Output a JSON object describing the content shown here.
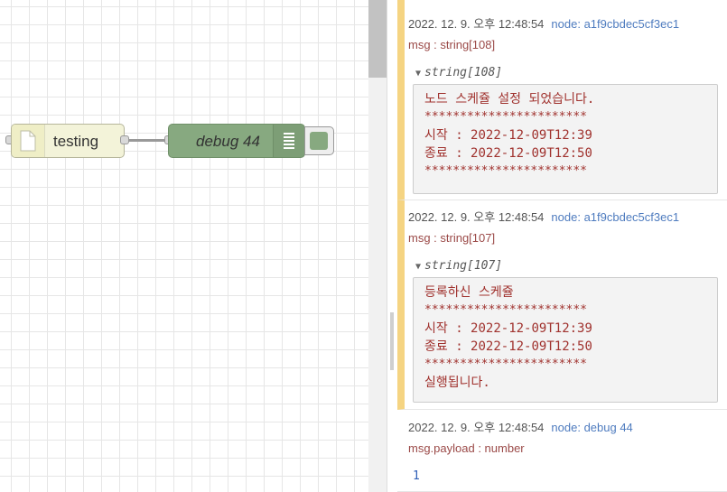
{
  "workspace": {
    "inject_node": {
      "label": "testing",
      "icon": "file-icon"
    },
    "debug_node": {
      "label": "debug 44",
      "icon": "list-icon"
    }
  },
  "debug_messages": [
    {
      "date": "2022. 12. 9. 오후 12:48:54",
      "node": "node: a1f9cbdec5cf3ec1",
      "topic": "msg : string[108]",
      "tree_label": "string[108]",
      "lines": [
        "노드 스케쥴 설정 되었습니다.",
        "***********************",
        "시작 : 2022-12-09T12:39",
        "종료 : 2022-12-09T12:50",
        "***********************"
      ]
    },
    {
      "date": "2022. 12. 9. 오후 12:48:54",
      "node": "node: a1f9cbdec5cf3ec1",
      "topic": "msg : string[107]",
      "tree_label": "string[107]",
      "lines": [
        "등록하신 스케쥴",
        "***********************",
        "시작 : 2022-12-09T12:39",
        "종료 : 2022-12-09T12:50",
        "***********************",
        "실행됩니다."
      ]
    },
    {
      "date": "2022. 12. 9. 오후 12:48:54",
      "node": "node: debug 44",
      "topic": "msg.payload : number",
      "value": "1"
    }
  ],
  "colors": {
    "inject_node": "#f3f3d9",
    "debug_node": "#87a980",
    "message_highlight": "#f5d482",
    "node_link": "#4f7cbf",
    "string_text": "#a0322e",
    "number_text": "#2f5fb6"
  }
}
